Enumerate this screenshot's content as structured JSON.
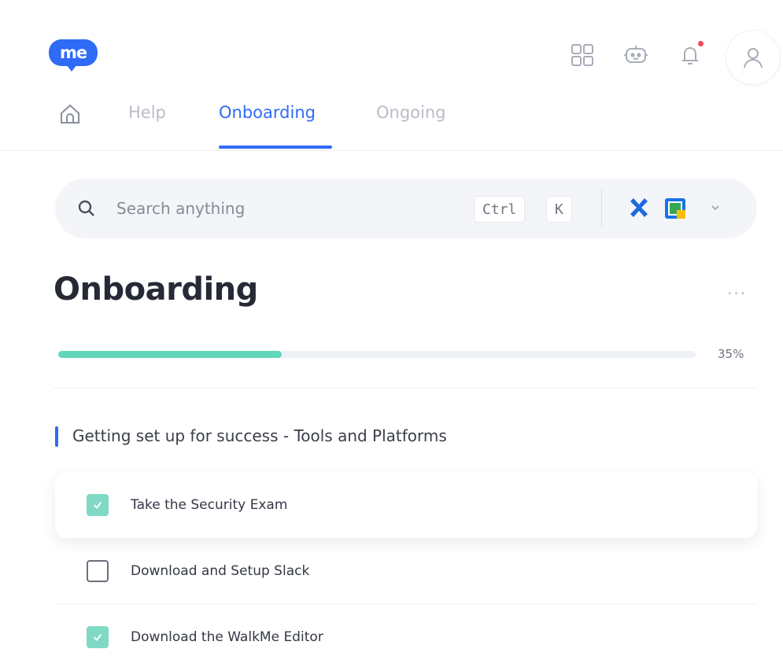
{
  "header": {
    "logo_text": "me",
    "icons": [
      "apps-grid-icon",
      "chatbot-icon",
      "bell-icon",
      "user-icon"
    ],
    "has_notification": true
  },
  "tabs": [
    {
      "label": "Help",
      "active": false
    },
    {
      "label": "Onboarding",
      "active": true
    },
    {
      "label": "Ongoing",
      "active": false
    }
  ],
  "search": {
    "placeholder": "Search anything",
    "shortcut_key1": "Ctrl",
    "shortcut_key2": "K"
  },
  "page": {
    "title": "Onboarding",
    "more_label": "...",
    "progress_value": 35,
    "progress_text": "35%"
  },
  "section": {
    "title": "Getting set up for success - Tools and Platforms"
  },
  "tasks": [
    {
      "label": "Take the Security Exam",
      "checked": true
    },
    {
      "label": "Download and Setup Slack",
      "checked": false
    },
    {
      "label": "Download the WalkMe Editor",
      "checked": true
    }
  ],
  "colors": {
    "accent": "#2f6bf6",
    "progress": "#62d6b9",
    "checked": "#7fd9c4",
    "notification": "#ef4a5e"
  }
}
